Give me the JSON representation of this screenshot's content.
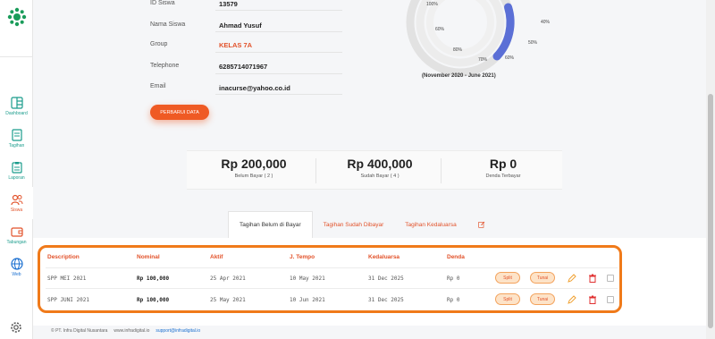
{
  "sidebar": {
    "items": [
      {
        "label": "Dashboard",
        "icon": "dashboard-icon"
      },
      {
        "label": "Tagihan",
        "icon": "invoice-icon"
      },
      {
        "label": "Laporan",
        "icon": "report-icon"
      },
      {
        "label": "Siswa",
        "icon": "students-icon"
      },
      {
        "label": "Tabungan",
        "icon": "savings-icon"
      },
      {
        "label": "Web",
        "icon": "globe-icon"
      }
    ]
  },
  "profile": {
    "fields": [
      {
        "label": "ID Siswa",
        "value": "13579"
      },
      {
        "label": "Nama Siswa",
        "value": "Ahmad Yusuf"
      },
      {
        "label": "Group",
        "value": "KELAS 7A"
      },
      {
        "label": "Telephone",
        "value": "6285714071967"
      },
      {
        "label": "Email",
        "value": "inacurse@yahoo.co.id"
      }
    ],
    "update_button": "PERBARUI DATA"
  },
  "progress": {
    "ticks": [
      "100%",
      "40%",
      "60%",
      "50%",
      "80%",
      "70%",
      "60%"
    ],
    "period": "(November 2020 - June 2021)"
  },
  "summary": [
    {
      "amount": "Rp 200,000",
      "label": "Belum Bayar ( 2 )"
    },
    {
      "amount": "Rp 400,000",
      "label": "Sudah Bayar ( 4 )"
    },
    {
      "amount": "Rp 0",
      "label": "Denda Terbayar"
    }
  ],
  "tabs": [
    "Tagihan Belum di Bayar",
    "Tagihan Sudah Dibayar",
    "Tagihan Kedaluarsa"
  ],
  "table": {
    "headers": [
      "Description",
      "Nominal",
      "Aktif",
      "J. Tempo",
      "Kedaluarsa",
      "Denda"
    ],
    "rows": [
      {
        "description": "SPP MEI 2021",
        "nominal": "Rp 100,000",
        "aktif": "25 Apr 2021",
        "tempo": "10 May 2021",
        "kedaluarsa": "31 Dec 2025",
        "denda": "Rp 0"
      },
      {
        "description": "SPP JUNI 2021",
        "nominal": "Rp 100,000",
        "aktif": "25 May 2021",
        "tempo": "10 Jun 2021",
        "kedaluarsa": "31 Dec 2025",
        "denda": "Rp 0"
      }
    ],
    "actions": {
      "split": "Split",
      "tunai": "Tunai"
    }
  },
  "footer": {
    "company": "© PT. Infra Digital Nusantara",
    "site": "www.infradigital.io",
    "email": "support@infradigital.io"
  },
  "colors": {
    "accent": "#ef5a24",
    "teal": "#1a9c8c",
    "highlight": "#f07a1a",
    "donut": "#5b6fd6"
  }
}
